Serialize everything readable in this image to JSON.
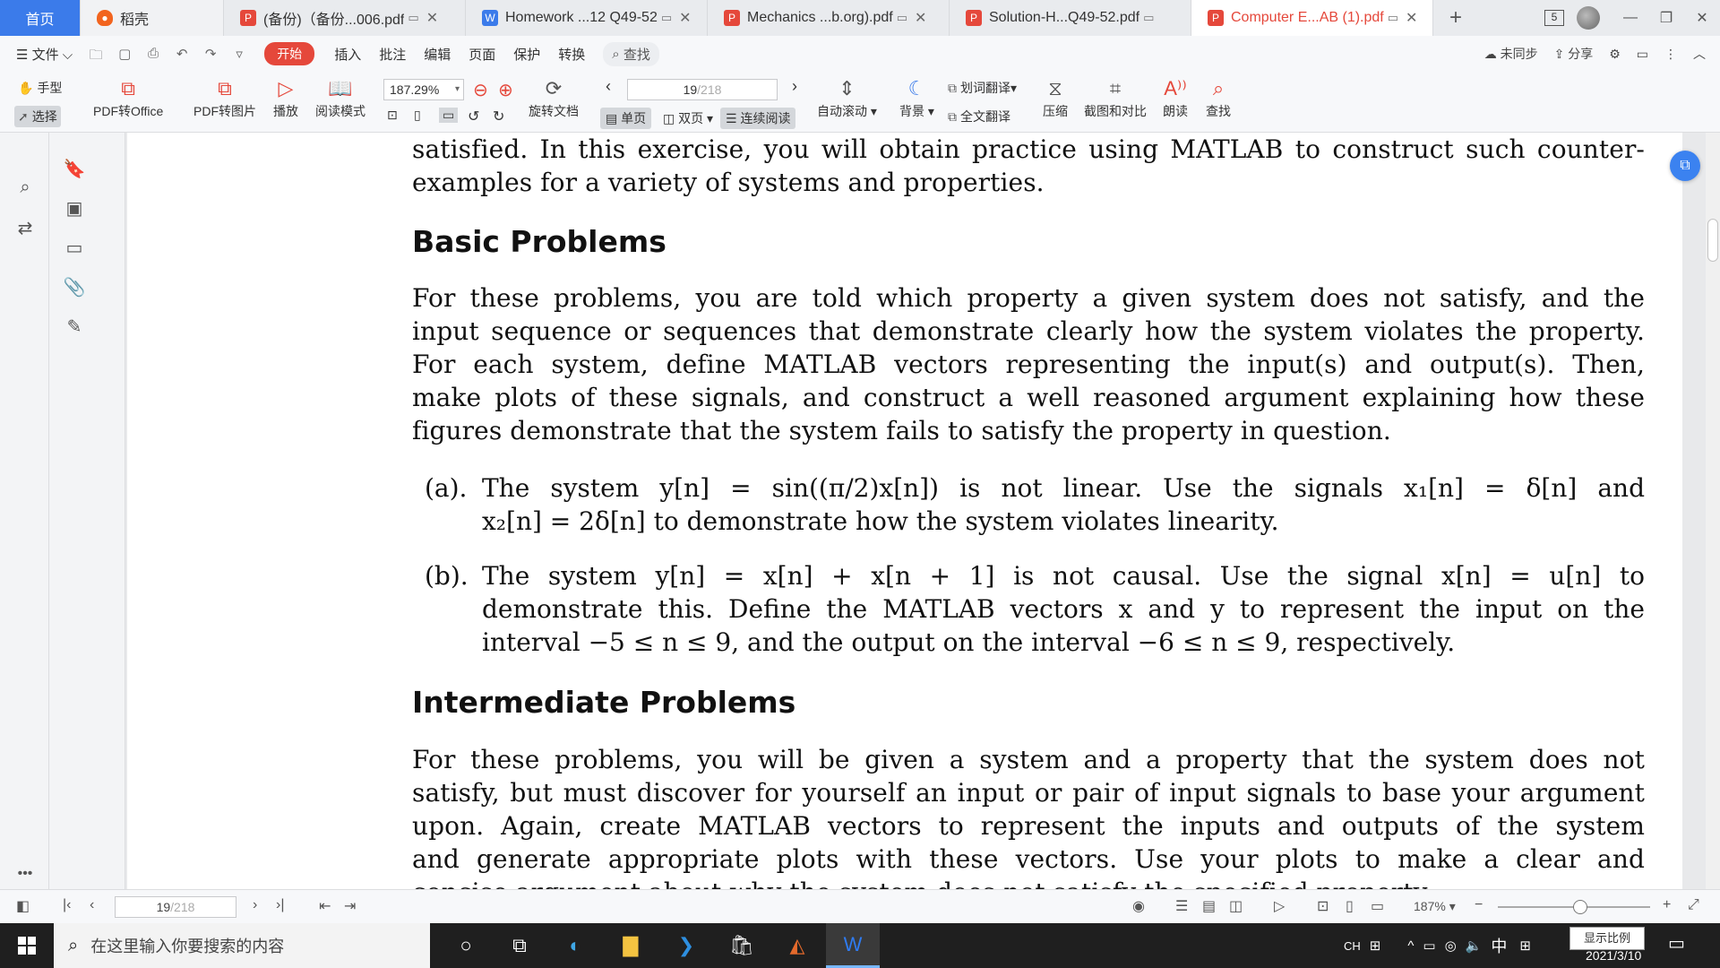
{
  "tabs": {
    "home": "首页",
    "daoke": "稻壳",
    "docs": [
      {
        "label": "(备份)（备份...006.pdf",
        "type": "pdf",
        "active": false
      },
      {
        "label": "Homework ...12 Q49-52",
        "type": "word",
        "active": false
      },
      {
        "label": "Mechanics ...b.org).pdf",
        "type": "pdf",
        "active": false
      },
      {
        "label": "Solution-H...Q49-52.pdf",
        "type": "pdf",
        "active": false
      },
      {
        "label": "Computer E...AB (1).pdf",
        "type": "pdf",
        "active": true
      }
    ],
    "window_count": "5"
  },
  "menubar": {
    "file": "文件",
    "start": "开始",
    "items": [
      "插入",
      "批注",
      "编辑",
      "页面",
      "保护",
      "转换"
    ],
    "search": "查找",
    "sync": "未同步",
    "share": "分享"
  },
  "ribbon": {
    "hand": "手型",
    "select": "选择",
    "pdf_to_office": "PDF转Office",
    "pdf_to_image": "PDF转图片",
    "play": "播放",
    "read_mode": "阅读模式",
    "zoom": "187.29%",
    "rotate": "旋转文档",
    "page_current": "19",
    "page_total": "/218",
    "single": "单页",
    "double": "双页",
    "continuous": "连续阅读",
    "auto_scroll": "自动滚动",
    "background": "背景",
    "word_translate": "划词翻译",
    "full_translate": "全文翻译",
    "compress": "压缩",
    "screenshot_compare": "截图和对比",
    "read_aloud": "朗读",
    "find": "查找"
  },
  "document": {
    "intro_lines": [
      "satisfied.  In this exercise, you will obtain practice using MATLAB to construct such counter-",
      "examples for a variety of systems and properties."
    ],
    "basic_heading": "Basic Problems",
    "basic_lines": [
      "For these problems, you are told which property a given system does not satisfy, and the",
      "input sequence or sequences that demonstrate clearly how the system violates the property.",
      "For each system, define MATLAB vectors representing the input(s) and output(s).  Then,",
      "make plots of these signals, and construct a well reasoned argument explaining how these",
      "figures demonstrate that the system fails to satisfy the property in question."
    ],
    "item_a_label": "(a).",
    "item_a_lines": [
      "The system y[n] = sin((π/2)x[n]) is not linear.  Use the signals x₁[n] = δ[n] and",
      "x₂[n] = 2δ[n] to demonstrate how the system violates linearity."
    ],
    "item_b_label": "(b).",
    "item_b_lines": [
      "The system y[n] = x[n] + x[n + 1] is not causal.  Use the signal x[n] = u[n] to",
      "demonstrate this. Define the MATLAB vectors x and y to represent the input on the",
      "interval −5 ≤ n ≤ 9, and the output on the interval −6 ≤ n ≤ 9, respectively."
    ],
    "intermediate_heading": "Intermediate Problems",
    "intermediate_lines": [
      "For these problems, you will be given a system and a property that the system does not",
      "satisfy, but must discover for yourself an input or pair of input signals to base your argument",
      "upon.  Again, create MATLAB vectors to represent the inputs and outputs of the system",
      "and generate appropriate plots with these vectors.  Use your plots to make a clear and",
      "concise argument about why the system does not satisfy the specified property."
    ]
  },
  "statusbar": {
    "page_current": "19",
    "page_total": "/218",
    "zoom": "187%"
  },
  "taskbar": {
    "search_placeholder": "在这里输入你要搜索的内容",
    "ime_lang": "中",
    "tooltip": "显示比例",
    "date": "2021/3/10"
  }
}
